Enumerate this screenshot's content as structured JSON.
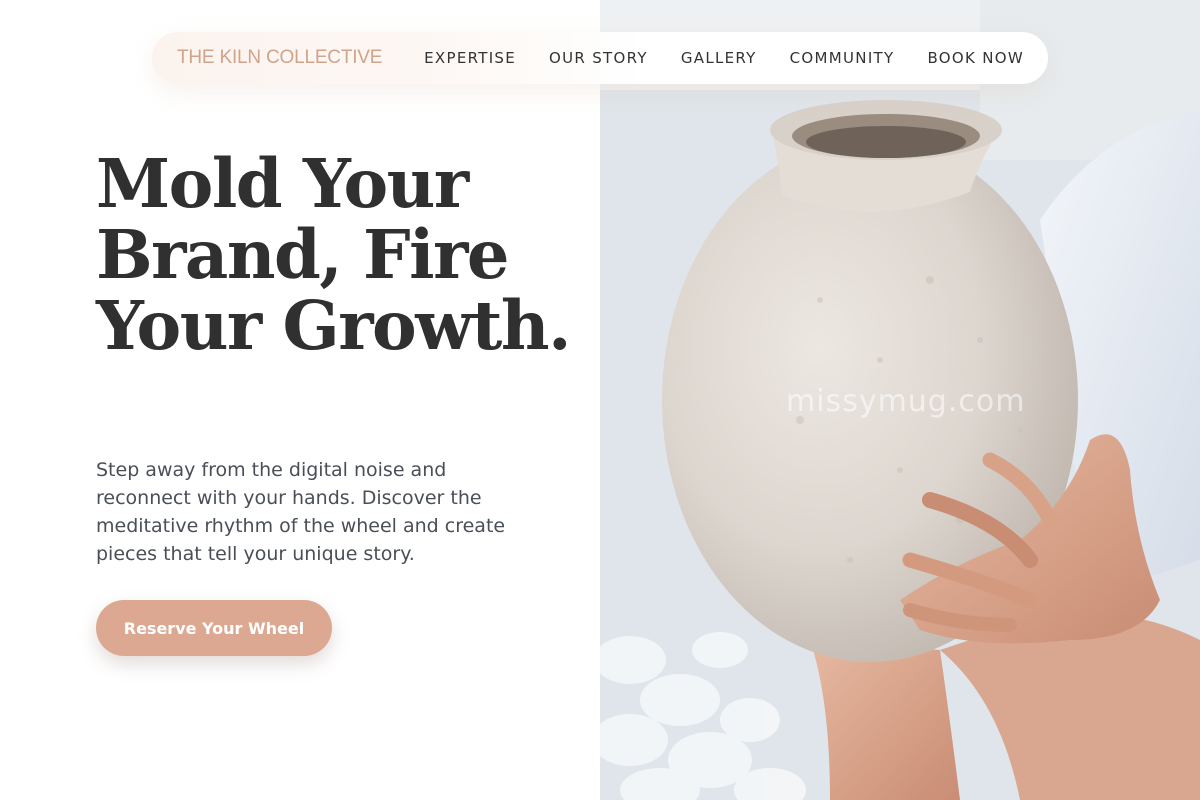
{
  "nav": {
    "brand": "THE KILN COLLECTIVE",
    "links": [
      "EXPERTISE",
      "OUR STORY",
      "GALLERY",
      "COMMUNITY",
      "BOOK NOW"
    ]
  },
  "hero": {
    "headline": "Mold Your Brand, Fire Your Growth.",
    "subtitle": "Step away from the digital noise and reconnect with your hands. Discover the meditative rhythm of the wheel and create pieces that tell your unique story.",
    "cta_label": "Reserve Your Wheel",
    "image_watermark": "missymug.com"
  },
  "colors": {
    "accent": "#dca892",
    "brand_text": "#d0a48b",
    "heading": "#303030",
    "body_text": "#4a4f57"
  }
}
